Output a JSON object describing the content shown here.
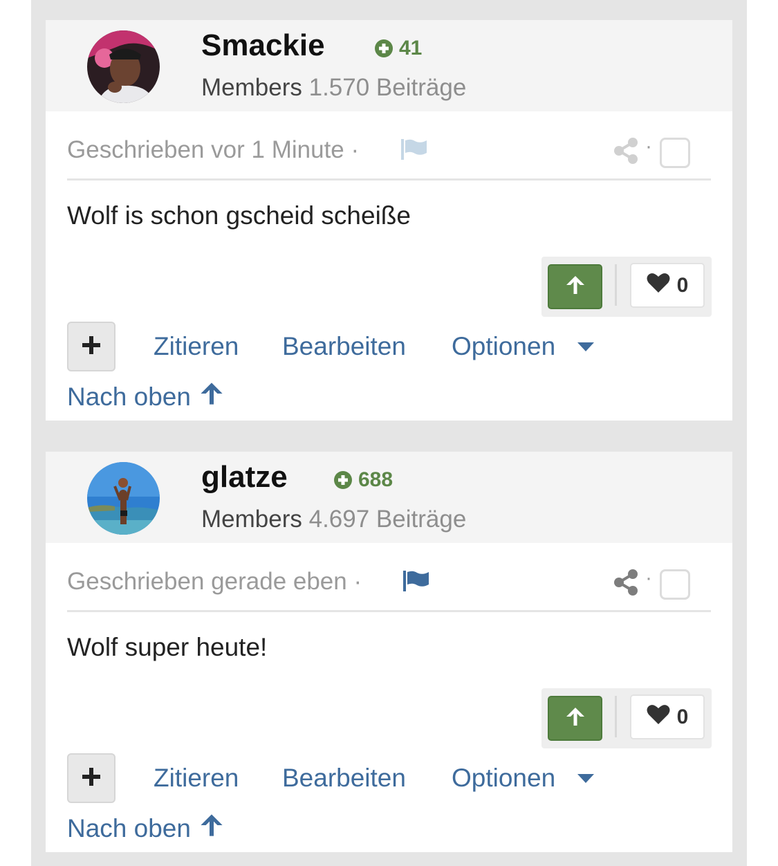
{
  "posts": [
    {
      "username": "Smackie",
      "reputation": "41",
      "group": "Members",
      "post_count": "1.570 Beiträge",
      "timestamp": "Geschrieben vor 1 Minute",
      "separator": "·",
      "content": "Wolf is schon gscheid scheiße",
      "like_count": "0",
      "actions": {
        "quote": "Zitieren",
        "edit": "Bearbeiten",
        "options": "Optionen"
      },
      "back_to_top": "Nach oben",
      "flag_color": "#c5d7e6",
      "share_color": "#d0d0d0"
    },
    {
      "username": "glatze",
      "reputation": "688",
      "group": "Members",
      "post_count": "4.697 Beiträge",
      "timestamp": "Geschrieben gerade eben",
      "separator": "·",
      "content": "Wolf super heute!",
      "like_count": "0",
      "actions": {
        "quote": "Zitieren",
        "edit": "Bearbeiten",
        "options": "Optionen"
      },
      "back_to_top": "Nach oben",
      "flag_color": "#3e6b9c",
      "share_color": "#7d7d7d"
    }
  ],
  "colors": {
    "link": "#3e6b9c",
    "reputation": "#5c8748",
    "upvote": "#5f8a4b",
    "background": "#e5e5e5"
  }
}
